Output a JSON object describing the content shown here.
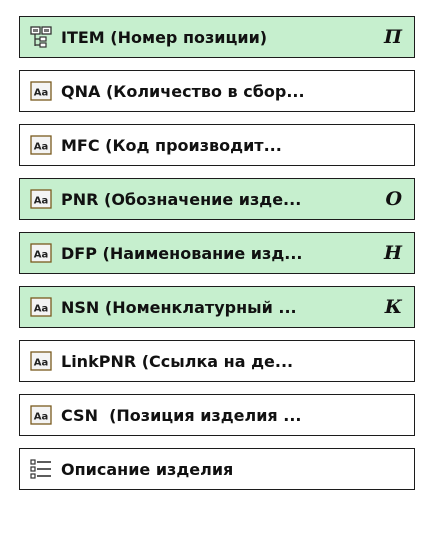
{
  "items": [
    {
      "label": "ITEM (Номер позиции)",
      "badge": "П",
      "icon": "structure-icon",
      "highlighted": true
    },
    {
      "label": "QNA (Количество в сбор...",
      "badge": "",
      "icon": "text-attribute-icon",
      "highlighted": false
    },
    {
      "label": "MFC (Код производит...",
      "badge": "",
      "icon": "text-attribute-icon",
      "highlighted": false
    },
    {
      "label": "PNR (Обозначение изде...",
      "badge": "О",
      "icon": "text-attribute-icon",
      "highlighted": true
    },
    {
      "label": "DFP (Наименование изд...",
      "badge": "Н",
      "icon": "text-attribute-icon",
      "highlighted": true
    },
    {
      "label": "NSN (Номенклатурный ...",
      "badge": "К",
      "icon": "text-attribute-icon",
      "highlighted": true
    },
    {
      "label": "LinkPNR (Ссылка на де...",
      "badge": "",
      "icon": "text-attribute-icon",
      "highlighted": false
    },
    {
      "label": "CSN  (Позиция изделия ...",
      "badge": "",
      "icon": "text-attribute-icon",
      "highlighted": false
    },
    {
      "label": "Описание изделия",
      "badge": "",
      "icon": "list-icon",
      "highlighted": false
    }
  ],
  "colors": {
    "highlight": "#c6efce",
    "border": "#1c1c1c"
  }
}
